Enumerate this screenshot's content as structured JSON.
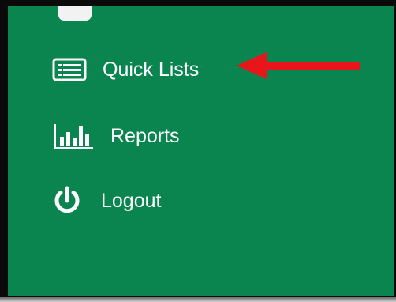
{
  "menu": {
    "items": [
      {
        "label": "Quick Lists",
        "icon": "list-icon"
      },
      {
        "label": "Reports",
        "icon": "bar-chart-icon"
      },
      {
        "label": "Logout",
        "icon": "power-icon"
      }
    ]
  },
  "colors": {
    "panel": "#0a8550",
    "text": "#ffffff",
    "arrow": "#e8161b",
    "frame": "#0a0a0a"
  }
}
